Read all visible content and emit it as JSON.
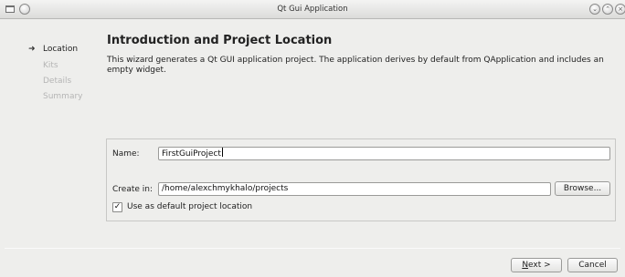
{
  "window": {
    "title": "Qt Gui Application",
    "controls": {
      "minimize": "⌄",
      "maximize": "⌃",
      "close": "×"
    }
  },
  "sidebar": {
    "current_marker": "➜",
    "steps": [
      {
        "label": "Location",
        "active": true
      },
      {
        "label": "Kits",
        "active": false
      },
      {
        "label": "Details",
        "active": false
      },
      {
        "label": "Summary",
        "active": false
      }
    ]
  },
  "page": {
    "title": "Introduction and Project Location",
    "description": "This wizard generates a Qt GUI application project. The application derives by default from QApplication and includes an empty widget."
  },
  "form": {
    "name_label": "Name:",
    "name_value": "FirstGuiProject",
    "createin_label": "Create in:",
    "path_value": "/home/alexchmykhalo/projects",
    "browse_label": "Browse...",
    "default_checked": true,
    "checkbox_mark": "✓",
    "default_label": "Use as default project location"
  },
  "footer": {
    "next_mnemonic": "N",
    "next_rest": "ext >",
    "cancel_label": "Cancel"
  },
  "colors": {
    "window_bg": "#eeeeec",
    "disabled_text": "#b5b5b5"
  }
}
